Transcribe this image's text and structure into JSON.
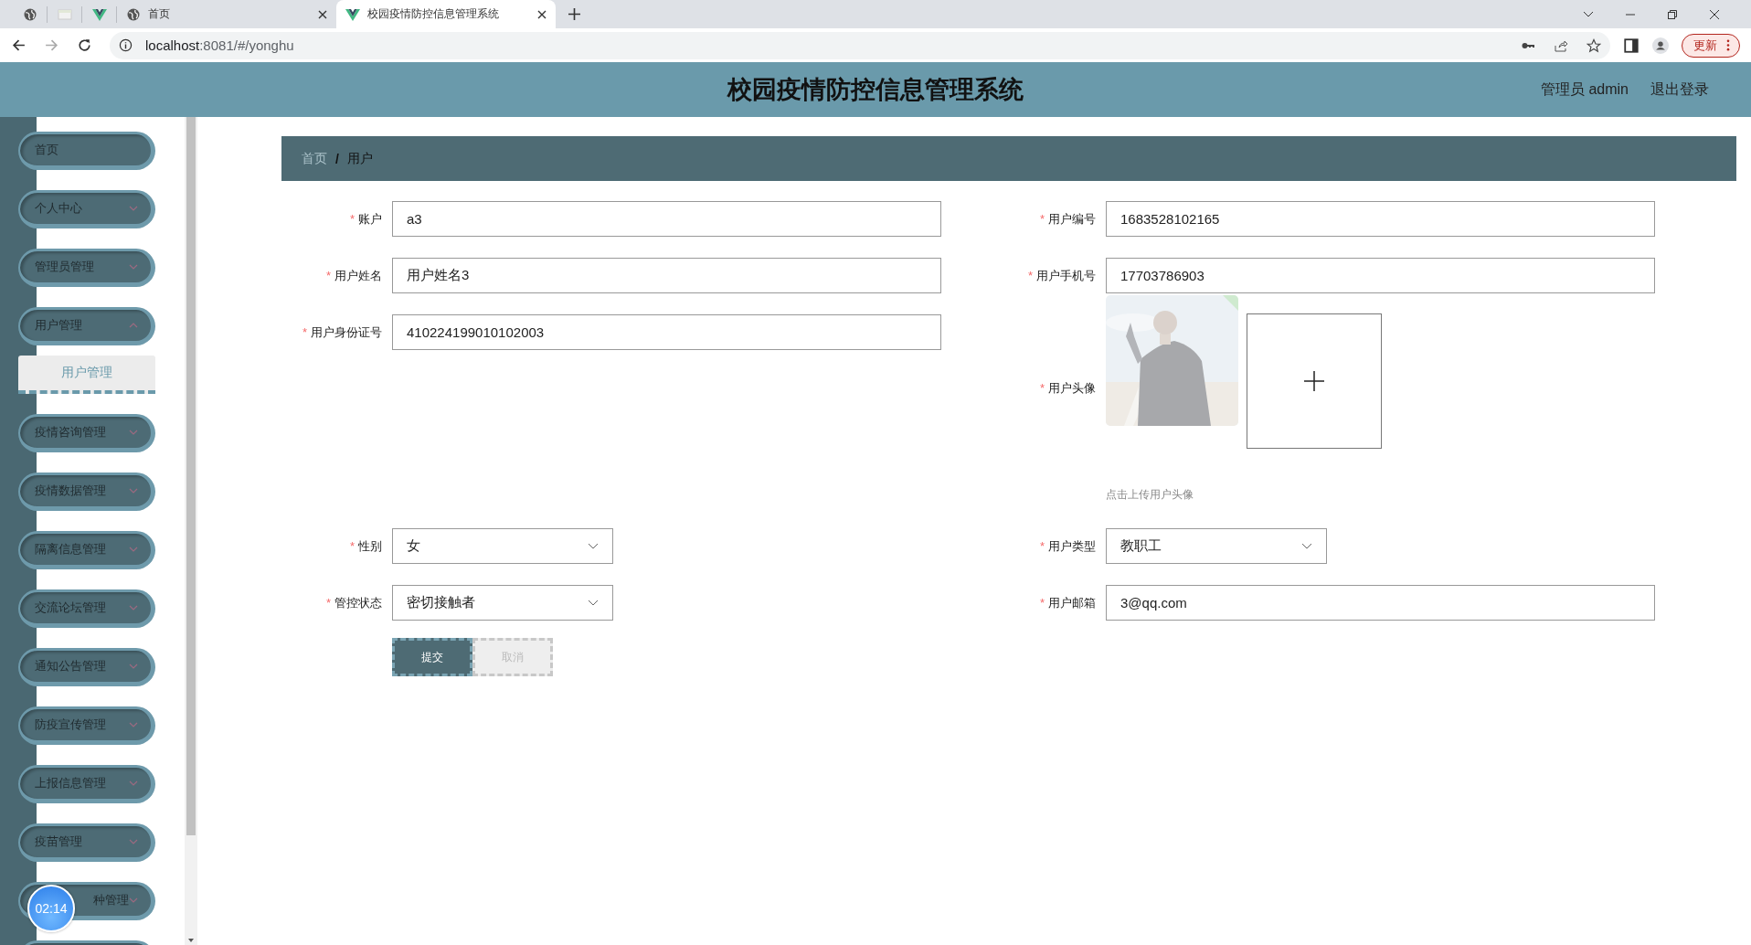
{
  "browser": {
    "tabs": [
      {
        "kind": "globe",
        "selected": false
      },
      {
        "kind": "page",
        "selected": false
      },
      {
        "kind": "vue",
        "selected": false
      },
      {
        "kind": "globe",
        "title": "首页",
        "selected": false
      },
      {
        "kind": "vue",
        "title": "校园疫情防控信息管理系统",
        "selected": true
      }
    ],
    "url_host": "localhost",
    "url_rest": ":8081/#/yonghu",
    "update_button": "更新"
  },
  "header": {
    "title": "校园疫情防控信息管理系统",
    "user": "管理员 admin",
    "logout": "退出登录"
  },
  "sidebar": {
    "items": [
      {
        "label": "首页",
        "kind": "link"
      },
      {
        "label": "个人中心",
        "kind": "group",
        "expanded": false
      },
      {
        "label": "管理员管理",
        "kind": "group",
        "expanded": false
      },
      {
        "label": "用户管理",
        "kind": "group",
        "expanded": true,
        "children": [
          {
            "label": "用户管理",
            "selected": true
          }
        ]
      },
      {
        "label": "疫情咨询管理",
        "kind": "group",
        "expanded": false
      },
      {
        "label": "疫情数据管理",
        "kind": "group",
        "expanded": false
      },
      {
        "label": "隔离信息管理",
        "kind": "group",
        "expanded": false
      },
      {
        "label": "交流论坛管理",
        "kind": "group",
        "expanded": false
      },
      {
        "label": "通知公告管理",
        "kind": "group",
        "expanded": false
      },
      {
        "label": "防疫宣传管理",
        "kind": "group",
        "expanded": false
      },
      {
        "label": "上报信息管理",
        "kind": "group",
        "expanded": false
      },
      {
        "label": "疫苗管理",
        "kind": "group",
        "expanded": false
      },
      {
        "label": "种管理",
        "kind": "group",
        "expanded": false,
        "covered": true
      }
    ],
    "timer": "02:14"
  },
  "breadcrumb": {
    "items": [
      "首页",
      "用户"
    ],
    "separator": "/"
  },
  "form": {
    "rows": [
      [
        {
          "label": "账户",
          "kind": "text",
          "value": "a3",
          "required_mark": "*"
        },
        {
          "label": "用户编号",
          "kind": "text",
          "value": "1683528102165",
          "required_mark": "*"
        }
      ],
      [
        {
          "label": "用户姓名",
          "kind": "text",
          "value": "用户姓名3",
          "required_mark": "*"
        },
        {
          "label": "用户手机号",
          "kind": "text",
          "value": "17703786903",
          "required_mark": "*"
        }
      ],
      [
        {
          "label": "用户身份证号",
          "kind": "text",
          "value": "410224199010102003",
          "required_mark": "*"
        },
        {
          "label": "用户头像",
          "hint": "点击上传用户头像",
          "uploaded": true,
          "required_mark": "*"
        }
      ],
      [
        {
          "label": "性别",
          "kind": "select",
          "value": "女",
          "required_mark": "*"
        },
        {
          "label": "用户类型",
          "kind": "select",
          "value": "教职工",
          "required_mark": "*"
        }
      ],
      [
        {
          "label": "管控状态",
          "kind": "select",
          "value": "密切接触者",
          "required_mark": "*"
        },
        {
          "label": "用户邮箱",
          "kind": "text",
          "value": "3@qq.com",
          "required_mark": "*"
        }
      ]
    ],
    "buttons": [
      {
        "label": "提交",
        "kind": "primary"
      },
      {
        "label": "取消",
        "kind": "cancel"
      }
    ]
  }
}
